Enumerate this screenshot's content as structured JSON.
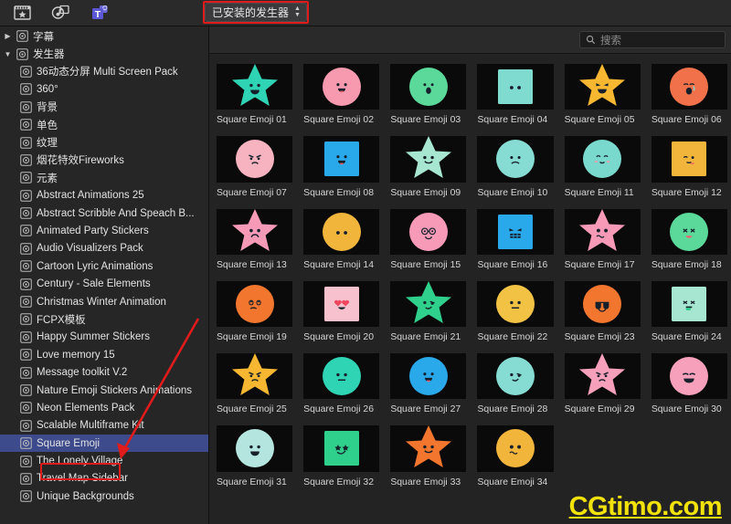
{
  "toolbar": {
    "icons": [
      {
        "name": "effects-browser-icon",
        "label": "效果"
      },
      {
        "name": "music-browser-icon",
        "label": "音频"
      },
      {
        "name": "titles-generators-browser-icon",
        "label": "字幕和发生器"
      }
    ],
    "popup": {
      "value": "已安装的发生器",
      "stepper_up": "▲",
      "stepper_down": "▼"
    }
  },
  "search": {
    "placeholder": "搜索",
    "value": "",
    "icon": "search-icon"
  },
  "sidebar": {
    "groups": [
      {
        "label": "字幕",
        "expanded": false,
        "disc": "▶"
      },
      {
        "label": "发生器",
        "expanded": true,
        "disc": "▼"
      }
    ],
    "items": [
      "36动态分屏 Multi Screen Pack",
      "360°",
      "背景",
      "单色",
      "纹理",
      "烟花特效Fireworks",
      "元素",
      "Abstract Animations 25",
      "Abstract Scribble And Speach B...",
      "Animated Party Stickers",
      "Audio Visualizers Pack",
      "Cartoon Lyric Animations",
      "Century - Sale Elements",
      "Christmas Winter Animation",
      "FCPX模板",
      "Happy Summer Stickers",
      "Love memory 15",
      "Message toolkit V.2",
      "Nature Emoji Stickers Animations",
      "Neon Elements Pack",
      "Scalable Multiframe Kit",
      "Square Emoji",
      "The Lonely Village",
      "Travel Map Sidebar",
      "Unique Backgrounds"
    ],
    "selected": "Square Emoji"
  },
  "browser": {
    "items": [
      {
        "label": "Square Emoji 01",
        "shape": "star",
        "color": "#2fd4b5",
        "face": "grin"
      },
      {
        "label": "Square Emoji 02",
        "shape": "circle",
        "color": "#f79ab0",
        "face": "tongue"
      },
      {
        "label": "Square Emoji 03",
        "shape": "circle",
        "color": "#5bd99a",
        "face": "shock"
      },
      {
        "label": "Square Emoji 04",
        "shape": "square",
        "color": "#7fdbd0",
        "face": "dots"
      },
      {
        "label": "Square Emoji 05",
        "shape": "star",
        "color": "#f7b731",
        "face": "evilgrin"
      },
      {
        "label": "Square Emoji 06",
        "shape": "circle",
        "color": "#f0714a",
        "face": "cry"
      },
      {
        "label": "Square Emoji 07",
        "shape": "circle",
        "color": "#f7b3bf",
        "face": "angry"
      },
      {
        "label": "Square Emoji 08",
        "shape": "square",
        "color": "#29a8ea",
        "face": "tongue"
      },
      {
        "label": "Square Emoji 09",
        "shape": "star",
        "color": "#a7e6d0",
        "face": "smile"
      },
      {
        "label": "Square Emoji 10",
        "shape": "circle",
        "color": "#86dbd2",
        "face": "confused"
      },
      {
        "label": "Square Emoji 11",
        "shape": "circle",
        "color": "#79d9cd",
        "face": "blush"
      },
      {
        "label": "Square Emoji 12",
        "shape": "square",
        "color": "#f2b53c",
        "face": "wink"
      },
      {
        "label": "Square Emoji 13",
        "shape": "star",
        "color": "#f79ab8",
        "face": "sad"
      },
      {
        "label": "Square Emoji 14",
        "shape": "circle",
        "color": "#f2b53c",
        "face": "dots"
      },
      {
        "label": "Square Emoji 15",
        "shape": "circle",
        "color": "#f79ab8",
        "face": "glasses"
      },
      {
        "label": "Square Emoji 16",
        "shape": "square",
        "color": "#29a8ea",
        "face": "teeth"
      },
      {
        "label": "Square Emoji 17",
        "shape": "star",
        "color": "#f79ab8",
        "face": "worried"
      },
      {
        "label": "Square Emoji 18",
        "shape": "circle",
        "color": "#5bd99a",
        "face": "sick"
      },
      {
        "label": "Square Emoji 19",
        "shape": "circle",
        "color": "#f2762e",
        "face": "roll"
      },
      {
        "label": "Square Emoji 20",
        "shape": "square",
        "color": "#f7c2cd",
        "face": "hearts"
      },
      {
        "label": "Square Emoji 21",
        "shape": "star",
        "color": "#2fcf8c",
        "face": "smirk"
      },
      {
        "label": "Square Emoji 22",
        "shape": "circle",
        "color": "#f2c245",
        "face": "flat"
      },
      {
        "label": "Square Emoji 23",
        "shape": "circle",
        "color": "#f2762e",
        "face": "sunglasses"
      },
      {
        "label": "Square Emoji 24",
        "shape": "square",
        "color": "#a7e6d0",
        "face": "vomit"
      },
      {
        "label": "Square Emoji 25",
        "shape": "star",
        "color": "#f7b731",
        "face": "angry"
      },
      {
        "label": "Square Emoji 26",
        "shape": "circle",
        "color": "#2fd4b5",
        "face": "flat"
      },
      {
        "label": "Square Emoji 27",
        "shape": "circle",
        "color": "#29a8ea",
        "face": "tongue"
      },
      {
        "label": "Square Emoji 28",
        "shape": "circle",
        "color": "#86dbd2",
        "face": "smirk"
      },
      {
        "label": "Square Emoji 29",
        "shape": "star",
        "color": "#f7a0bb",
        "face": "angry"
      },
      {
        "label": "Square Emoji 30",
        "shape": "circle",
        "color": "#f7a0bb",
        "face": "laugh"
      },
      {
        "label": "Square Emoji 31",
        "shape": "circle",
        "color": "#b4e6df",
        "face": "grin"
      },
      {
        "label": "Square Emoji 32",
        "shape": "square",
        "color": "#2fcf8c",
        "face": "stars"
      },
      {
        "label": "Square Emoji 33",
        "shape": "star",
        "color": "#f2762e",
        "face": "smile"
      },
      {
        "label": "Square Emoji 34",
        "shape": "circle",
        "color": "#f2b53c",
        "face": "worried"
      }
    ]
  },
  "watermark": {
    "text": "CGtimo.com",
    "color": "#f2e20c"
  },
  "annotations": {
    "popup_highlight_color": "#e01b1b",
    "selection_highlight_color": "#e01b1b",
    "arrow_color": "#e01b1b",
    "selected_row_color": "#3d4a8c"
  }
}
